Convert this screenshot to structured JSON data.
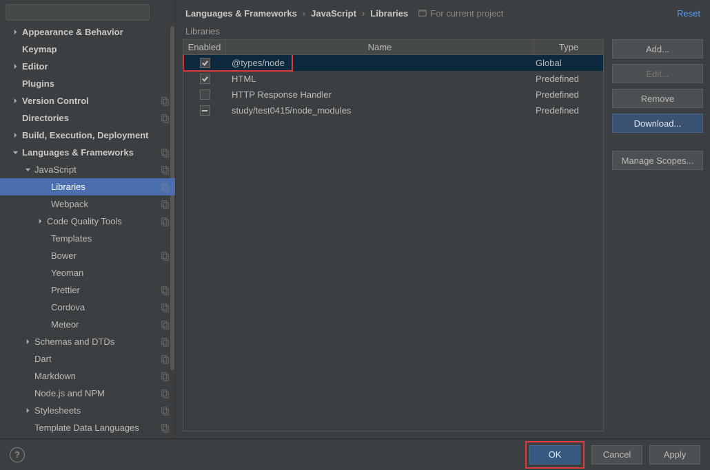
{
  "search": {
    "placeholder": ""
  },
  "sidebar": {
    "items": [
      {
        "label": "Appearance & Behavior",
        "depth": 0,
        "bold": true,
        "arrow": "right",
        "copy": false
      },
      {
        "label": "Keymap",
        "depth": 0,
        "bold": true,
        "arrow": "",
        "copy": false
      },
      {
        "label": "Editor",
        "depth": 0,
        "bold": true,
        "arrow": "right",
        "copy": false
      },
      {
        "label": "Plugins",
        "depth": 0,
        "bold": true,
        "arrow": "",
        "copy": false
      },
      {
        "label": "Version Control",
        "depth": 0,
        "bold": true,
        "arrow": "right",
        "copy": true
      },
      {
        "label": "Directories",
        "depth": 0,
        "bold": true,
        "arrow": "",
        "copy": true
      },
      {
        "label": "Build, Execution, Deployment",
        "depth": 0,
        "bold": true,
        "arrow": "right",
        "copy": false
      },
      {
        "label": "Languages & Frameworks",
        "depth": 0,
        "bold": true,
        "arrow": "down",
        "copy": true
      },
      {
        "label": "JavaScript",
        "depth": 1,
        "bold": false,
        "arrow": "down",
        "copy": true
      },
      {
        "label": "Libraries",
        "depth": 3,
        "bold": false,
        "arrow": "",
        "copy": true,
        "selected": true
      },
      {
        "label": "Webpack",
        "depth": 3,
        "bold": false,
        "arrow": "",
        "copy": true
      },
      {
        "label": "Code Quality Tools",
        "depth": 2,
        "bold": false,
        "arrow": "right",
        "copy": true
      },
      {
        "label": "Templates",
        "depth": 3,
        "bold": false,
        "arrow": "",
        "copy": false
      },
      {
        "label": "Bower",
        "depth": 3,
        "bold": false,
        "arrow": "",
        "copy": true
      },
      {
        "label": "Yeoman",
        "depth": 3,
        "bold": false,
        "arrow": "",
        "copy": false
      },
      {
        "label": "Prettier",
        "depth": 3,
        "bold": false,
        "arrow": "",
        "copy": true
      },
      {
        "label": "Cordova",
        "depth": 3,
        "bold": false,
        "arrow": "",
        "copy": true
      },
      {
        "label": "Meteor",
        "depth": 3,
        "bold": false,
        "arrow": "",
        "copy": true
      },
      {
        "label": "Schemas and DTDs",
        "depth": 1,
        "bold": false,
        "arrow": "right",
        "copy": true
      },
      {
        "label": "Dart",
        "depth": 1,
        "bold": false,
        "arrow": "",
        "copy": true
      },
      {
        "label": "Markdown",
        "depth": 1,
        "bold": false,
        "arrow": "",
        "copy": true
      },
      {
        "label": "Node.js and NPM",
        "depth": 1,
        "bold": false,
        "arrow": "",
        "copy": true
      },
      {
        "label": "Stylesheets",
        "depth": 1,
        "bold": false,
        "arrow": "right",
        "copy": true
      },
      {
        "label": "Template Data Languages",
        "depth": 1,
        "bold": false,
        "arrow": "",
        "copy": true
      }
    ]
  },
  "breadcrumb": {
    "seg0": "Languages & Frameworks",
    "seg1": "JavaScript",
    "seg2": "Libraries",
    "proj_label": "For current project",
    "reset": "Reset"
  },
  "section": {
    "title": "Libraries"
  },
  "table": {
    "headers": {
      "enabled": "Enabled",
      "name": "Name",
      "type": "Type"
    },
    "rows": [
      {
        "checked": "checked",
        "name": "@types/node",
        "type": "Global",
        "selected": true
      },
      {
        "checked": "checked",
        "name": "HTML",
        "type": "Predefined",
        "selected": false
      },
      {
        "checked": "unchecked",
        "name": "HTTP Response Handler",
        "type": "Predefined",
        "selected": false
      },
      {
        "checked": "mixed",
        "name": "study/test0415/node_modules",
        "type": "Predefined",
        "selected": false
      }
    ]
  },
  "buttons": {
    "add": "Add...",
    "edit": "Edit...",
    "remove": "Remove",
    "download": "Download...",
    "manage_scopes": "Manage Scopes..."
  },
  "footer": {
    "ok": "OK",
    "cancel": "Cancel",
    "apply": "Apply"
  }
}
